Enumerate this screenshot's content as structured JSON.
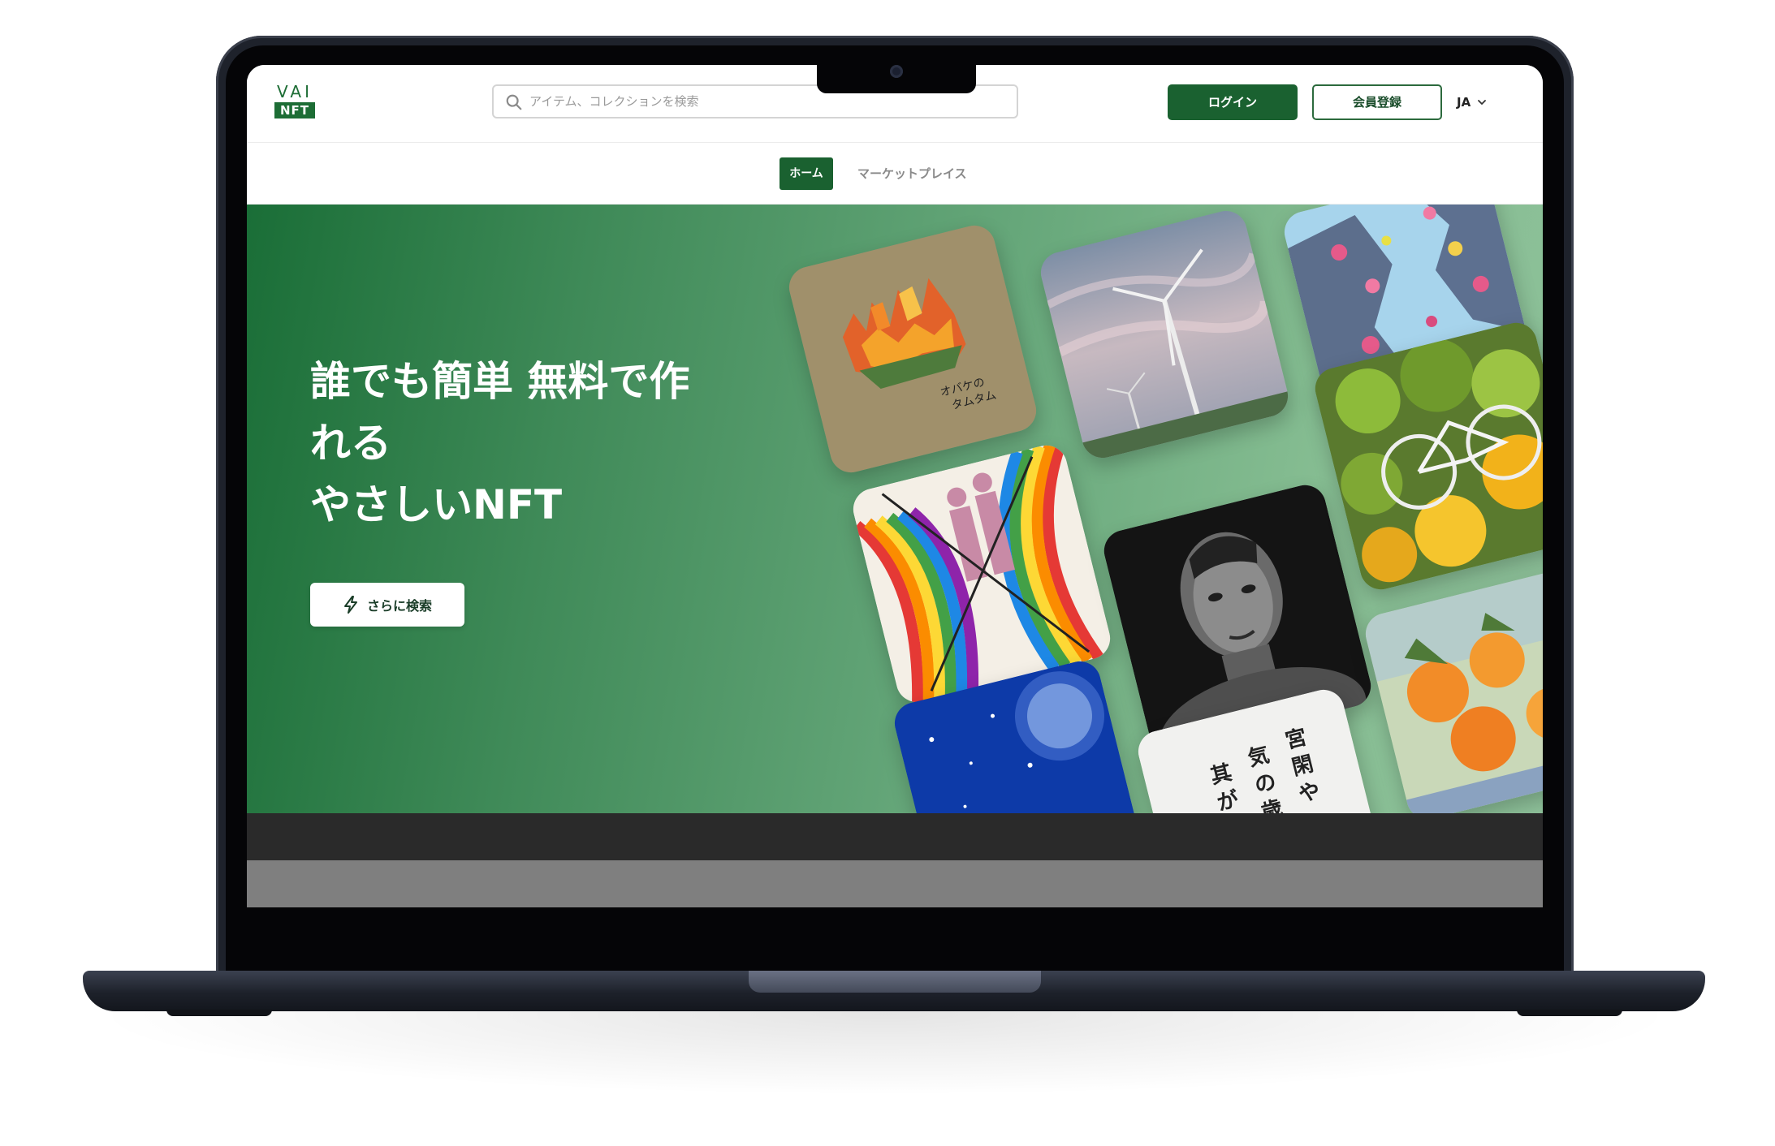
{
  "header": {
    "logo_top": "VAI",
    "logo_bottom": "NFT",
    "search_placeholder": "アイテム、コレクションを検索",
    "search_icon": "search-icon",
    "login_label": "ログイン",
    "register_label": "会員登録",
    "language": "JA",
    "language_icon": "chevron-down-icon"
  },
  "nav": {
    "tabs": [
      {
        "label": "ホーム",
        "active": true
      },
      {
        "label": "マーケットプレイス",
        "active": false
      }
    ]
  },
  "hero": {
    "title_lines": [
      "誰でも簡単 無料で作",
      "れる",
      "やさしいNFT"
    ],
    "button_label": "さらに検索",
    "button_icon": "lightning-icon",
    "card_texts": {
      "balloon_caption_1": "オバケの",
      "balloon_caption_2": "タムタム",
      "poem_line_1": "宮",
      "poem_line_2": "閑",
      "poem_line_3": "や",
      "poem_line_4": "気",
      "poem_line_5": "の",
      "poem_line_6": "歳",
      "poem_line_7": "其",
      "poem_line_8": "が"
    }
  },
  "colors": {
    "brand_green": "#1a6130",
    "hero_gradient_start": "#1a6e37",
    "hero_gradient_end": "#8ec19a"
  }
}
